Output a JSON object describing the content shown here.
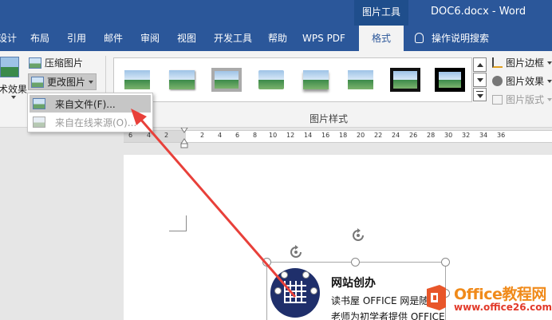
{
  "titlebar": {
    "context_tab": "图片工具",
    "doc_title": "DOC6.docx  -  Word"
  },
  "tabs": [
    {
      "label": "设计",
      "name": "tab-design"
    },
    {
      "label": "布局",
      "name": "tab-layout"
    },
    {
      "label": "引用",
      "name": "tab-references"
    },
    {
      "label": "邮件",
      "name": "tab-mailings"
    },
    {
      "label": "审阅",
      "name": "tab-review"
    },
    {
      "label": "视图",
      "name": "tab-view"
    },
    {
      "label": "开发工具",
      "name": "tab-developer"
    },
    {
      "label": "帮助",
      "name": "tab-help"
    },
    {
      "label": "WPS PDF",
      "name": "tab-wps-pdf"
    },
    {
      "label": "格式",
      "name": "tab-format"
    }
  ],
  "active_tab": "格式",
  "tell_me": "操作说明搜索",
  "ribbon": {
    "left_cut_label": "术效果",
    "compress_label": "压缩图片",
    "change_label": "更改图片",
    "styles_group_label": "图片样式",
    "picture_border": "图片边框",
    "picture_effects": "图片效果",
    "picture_layout": "图片版式"
  },
  "dropdown": {
    "items": [
      {
        "label": "来自文件(F)...",
        "state": "highlighted"
      },
      {
        "label": "来自在线来源(O)...",
        "state": "disabled"
      }
    ]
  },
  "ruler": {
    "labels": [
      "6",
      "4",
      "2",
      "2",
      "4",
      "6",
      "8",
      "10",
      "12",
      "14",
      "16",
      "18",
      "20",
      "22",
      "24",
      "26",
      "28",
      "30",
      "32",
      "34",
      "36"
    ]
  },
  "document": {
    "heading": "网站创办",
    "line1": "读书屋  OFFICE  网是随",
    "line2": "老师为初学者提供 OFFICE"
  },
  "watermark": {
    "brand": "Office教程网",
    "site": "www.office26.com"
  },
  "colors": {
    "ribbon_blue": "#2b579a",
    "context_blue": "#1f4e8c",
    "arrow_red": "#e8403a",
    "watermark_orange": "#f08a1a"
  }
}
